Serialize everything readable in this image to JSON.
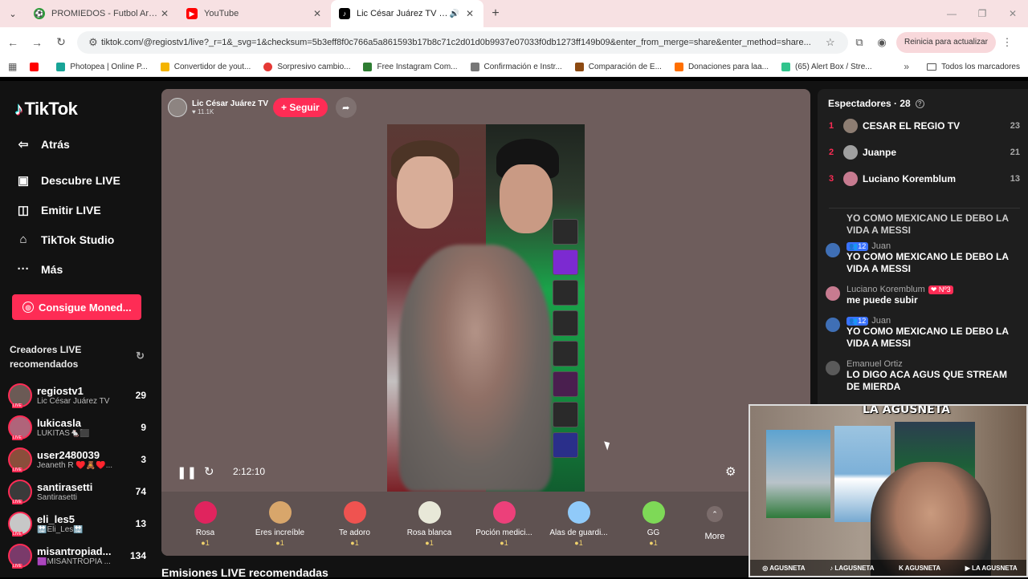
{
  "browser": {
    "tabs": [
      {
        "title": "PROMIEDOS - Futbol Argentino",
        "color": "#2e9c3a",
        "icon": "promiedos-icon",
        "active": false
      },
      {
        "title": "YouTube",
        "color": "#ff0000",
        "icon": "youtube-icon",
        "active": false
      },
      {
        "title": "Lic César Juárez TV (@regiostv1)",
        "color": "#000000",
        "icon": "tiktok-icon",
        "active": true
      }
    ],
    "url": "tiktok.com/@regiostv1/live?_r=1&_svg=1&checksum=5b3eff8f0c766a5a861593b17b8c71c2d01d0b9937e07033f0db1273ff149b09&enter_from_merge=share&enter_method=share...",
    "update_button": "Reinicia para actualizar",
    "bookmarks": [
      {
        "label": "",
        "color": "#ff0000"
      },
      {
        "label": "Photopea | Online P...",
        "color": "#18a497"
      },
      {
        "label": "Convertidor de yout...",
        "color": "#f4b400"
      },
      {
        "label": "Sorpresivo cambio...",
        "color": "#e53935"
      },
      {
        "label": "Free Instagram Com...",
        "color": "#2e7d32"
      },
      {
        "label": "Confirmación e Instr...",
        "color": "#777777"
      },
      {
        "label": "Comparación de E...",
        "color": "#8d4a12"
      },
      {
        "label": "Donaciones para laa...",
        "color": "#ff6f00"
      },
      {
        "label": "(65) Alert Box / Stre...",
        "color": "#31c48d"
      }
    ],
    "all_bookmarks": "Todos los marcadores"
  },
  "tiktok": {
    "logo": "TikTok",
    "nav": [
      {
        "label": "Atrás",
        "icon": "back-arrow-icon",
        "glyph": "⇦"
      },
      {
        "label": "Descubre LIVE",
        "icon": "live-tv-icon",
        "glyph": "▣"
      },
      {
        "label": "Emitir LIVE",
        "icon": "video-camera-icon",
        "glyph": "◫"
      },
      {
        "label": "TikTok Studio",
        "icon": "studio-icon",
        "glyph": "⌂"
      },
      {
        "label": "Más",
        "icon": "more-dots-icon",
        "glyph": "···"
      }
    ],
    "coins_button": "Consigue Moned...",
    "creators_heading": "Creadores LIVE recomendados",
    "creators": [
      {
        "name": "regiostv1",
        "sub": "Lic César Juárez TV",
        "count": "29",
        "color": "#6b5a55"
      },
      {
        "name": "lukicasla",
        "sub": "LUKITAS🐁⬛",
        "count": "9",
        "color": "#b0647a"
      },
      {
        "name": "user2480039",
        "sub": "Jeaneth R ♥️🧸♥️...",
        "count": "3",
        "color": "#8a4e3b"
      },
      {
        "name": "santirasetti",
        "sub": "Santirasetti",
        "count": "74",
        "color": "#3a3a3a"
      },
      {
        "name": "eli_les5",
        "sub": "🔛Eli_Les🔛",
        "count": "13",
        "color": "#c7c7c7"
      },
      {
        "name": "misantropiad...",
        "sub": "🟪MISANTROPIA ...",
        "count": "134",
        "color": "#7a3a6a"
      }
    ],
    "live": {
      "host_name": "Lic César Juárez TV",
      "host_likes": "♥ 11.1K",
      "follow_label": "+ Seguir",
      "timer": "2:12:10",
      "gifts": [
        {
          "name": "Rosa",
          "cost": "●1",
          "color": "#e0245e"
        },
        {
          "name": "Eres increíble",
          "cost": "●1",
          "color": "#d8a66b"
        },
        {
          "name": "Te adoro",
          "cost": "●1",
          "color": "#ef5350"
        },
        {
          "name": "Rosa blanca",
          "cost": "●1",
          "color": "#e8e8d8"
        },
        {
          "name": "Poción medici...",
          "cost": "●1",
          "color": "#ec407a"
        },
        {
          "name": "Alas de guardi...",
          "cost": "●1",
          "color": "#90caf9"
        },
        {
          "name": "GG",
          "cost": "●1",
          "color": "#7ed957"
        }
      ],
      "more_label": "More"
    },
    "recommended_heading": "Emisiones LIVE recomendadas",
    "viewers": {
      "heading": "Espectadores · 28",
      "top": [
        {
          "rank": "1",
          "name": "CESAR EL REGIO TV",
          "score": "23",
          "color": "#8d7d72"
        },
        {
          "rank": "2",
          "name": "Juanpe",
          "score": "21",
          "color": "#a0a0a0"
        },
        {
          "rank": "3",
          "name": "Luciano Koremblum",
          "score": "13",
          "color": "#c77b90"
        }
      ]
    },
    "chat": [
      {
        "user": "",
        "badge": "",
        "badge2": "",
        "text": "YO COMO MEXICANO LE DEBO LA VIDA A MESSI",
        "color": "#1e1e1e"
      },
      {
        "user": "Juan",
        "badge": "👥12",
        "badge2": "",
        "text": "YO COMO MEXICANO LE DEBO LA VIDA A MESSI",
        "color": "#3f6fb5"
      },
      {
        "user": "Luciano Koremblum",
        "badge": "",
        "badge2": "❤ Nº3",
        "text": "me puede subir",
        "color": "#c77b90"
      },
      {
        "user": "Juan",
        "badge": "👥12",
        "badge2": "",
        "text": "YO COMO MEXICANO LE DEBO LA VIDA A MESSI",
        "color": "#3f6fb5"
      },
      {
        "user": "Emanuel Ortiz",
        "badge": "",
        "badge2": "",
        "text": "LO DIGO ACA AGUS QUE STREAM DE MIERDA",
        "color": "#5a5a5a"
      }
    ]
  },
  "overlay": {
    "brand": "LA AGUSNETA",
    "socials": [
      "◎ AGUSNETA",
      "♪ LAGUSNETA",
      "K AGUSNETA",
      "▶ LA AGUSNETA"
    ]
  }
}
